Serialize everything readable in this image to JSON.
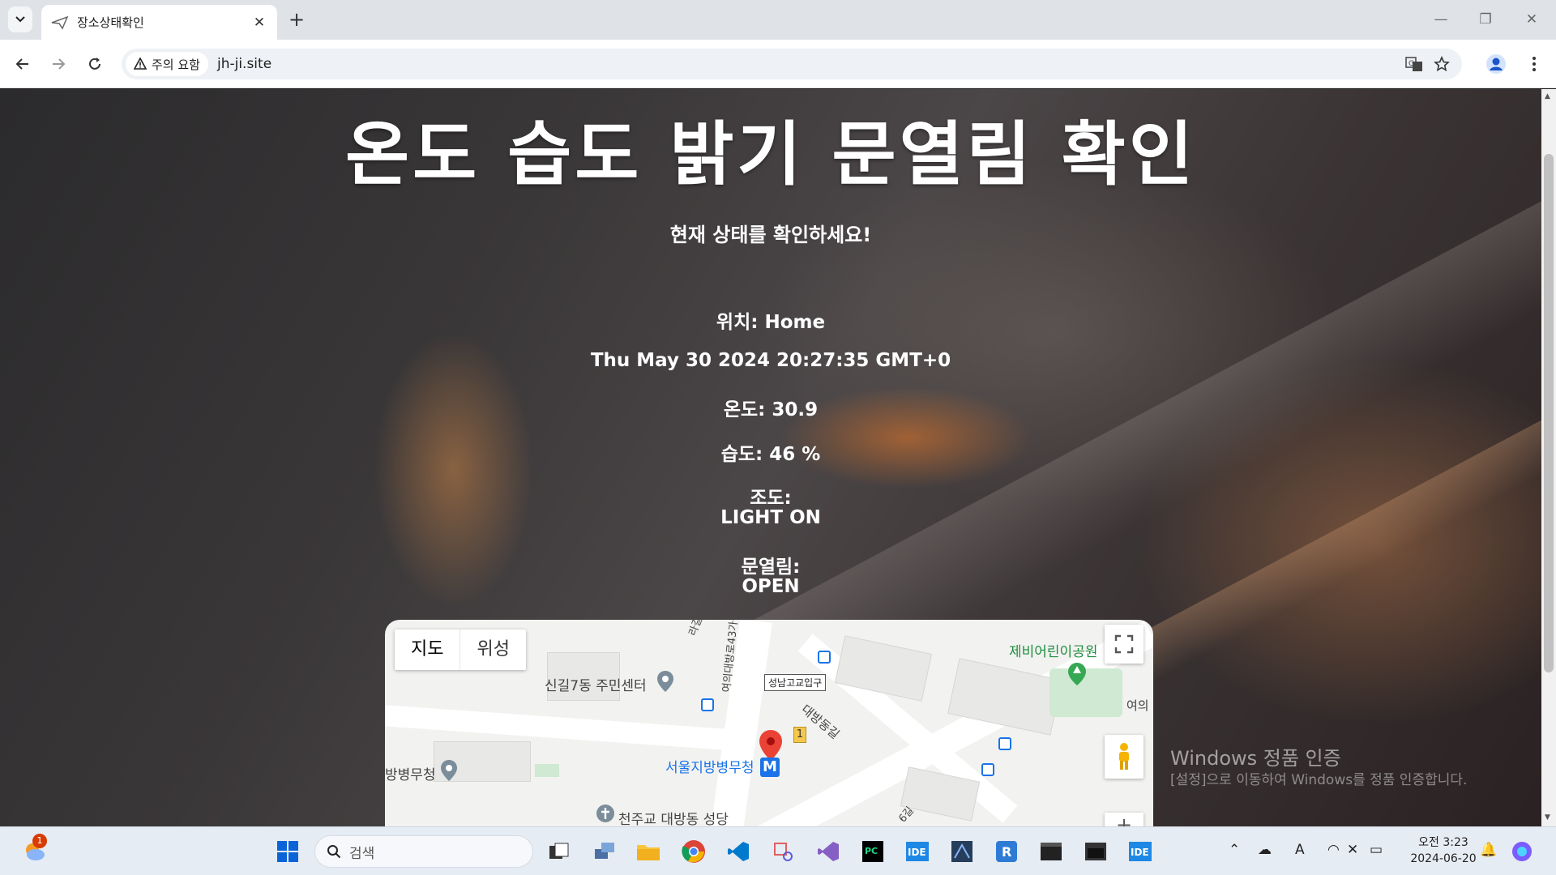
{
  "browser": {
    "tab_title": "장소상태확인",
    "security_chip": "주의 요함",
    "url": "jh-ji.site"
  },
  "page": {
    "title": "온도 습도 밝기 문열림 확인",
    "subtitle": "현재 상태를 확인하세요!",
    "location": "위치: Home",
    "datetime": "Thu May 30 2024 20:27:35 GMT+0",
    "temperature": "온도: 30.9",
    "humidity": "습도: 46 %",
    "light_label": "조도:",
    "light_value": "LIGHT ON",
    "door_label": "문열림:",
    "door_value": "OPEN"
  },
  "map": {
    "type_map": "지도",
    "type_satellite": "위성",
    "labels": {
      "community_center": "신길7동 주민센터",
      "park": "제비어린이공원",
      "station": "서울지방병무청",
      "left_cut": "방병무청",
      "church": "천주교 대방동 성당",
      "road1": "대방동길",
      "road2": "여의대방로43가길",
      "bus_stop": "성남고교입구",
      "exit_number": "1",
      "road_partial": "여의",
      "road_partial2": "라길",
      "road_partial3": "6길"
    }
  },
  "watermark": {
    "line1": "Windows 정품 인증",
    "line2": "[설정]으로 이동하여 Windows를 정품 인증합니다."
  },
  "taskbar": {
    "search_placeholder": "검색",
    "notification_count": "1",
    "time": "오전 3:23",
    "date": "2024-06-20"
  }
}
